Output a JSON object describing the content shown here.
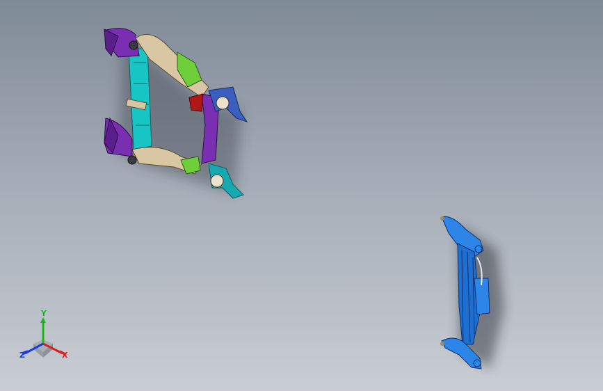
{
  "viewport": {
    "background_top": "#7f8a97",
    "background_bottom": "#c9cdd3"
  },
  "models": [
    {
      "name": "subframe-assembly-isometric",
      "colors": [
        "#17c5c4",
        "#7a2fb3",
        "#d9c7a3",
        "#6fcf3a",
        "#b01818"
      ]
    },
    {
      "name": "subframe-assembly-side",
      "colors": [
        "#1f6fd1",
        "#2d85e8",
        "#9b8a6a"
      ]
    }
  ],
  "triad": {
    "y_label": "Y",
    "x_label": "X",
    "z_label": "Z",
    "y_color": "#1bb81b",
    "x_color": "#e01b1b",
    "z_color": "#1b3bd8"
  }
}
